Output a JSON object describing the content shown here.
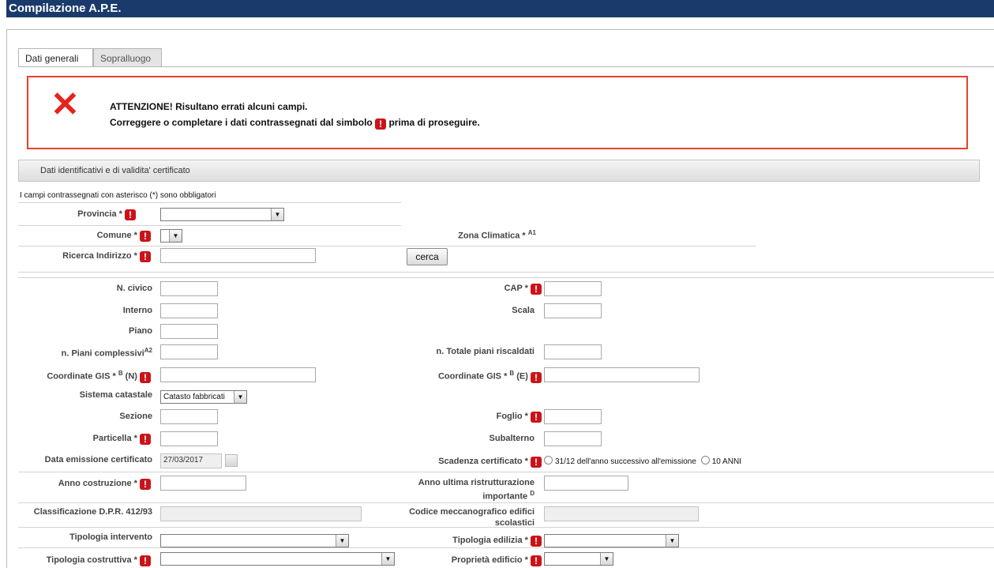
{
  "window_title": "Compilazione A.P.E.",
  "tabs": [
    {
      "label": "Dati generali"
    },
    {
      "label": "Sopralluogo"
    }
  ],
  "alert": {
    "line1": "ATTENZIONE! Risultano errati alcuni campi.",
    "line2_pre": "Correggere o completare i dati contrassegnati dal simbolo",
    "line2_post": "prima di proseguire.",
    "error_icon": "close-icon",
    "error_color": "#e8231b"
  },
  "error_marker": "!",
  "section_title": "Dati identificativi e di validita' certificato",
  "required_note": "I campi contrassegnati con asterisco (*) sono obbligatori",
  "location": {
    "provincia_label": "Provincia *",
    "comune_label": "Comune *",
    "zona_label": "Zona Climatica *",
    "zona_sup": "A1",
    "ricerca_label": "Ricerca Indirizzo *",
    "cerca_button": "cerca"
  },
  "fields": {
    "n_civico": "N. civico",
    "cap": "CAP *",
    "interno": "Interno",
    "scala": "Scala",
    "piano": "Piano",
    "n_piani": "n. Piani complessivi",
    "n_piani_sup": "A2",
    "n_totale": "n. Totale piani riscaldati",
    "gis_n_pre": "Coordinate GIS *",
    "gis_sup": "B",
    "gis_n_post": "(N)",
    "gis_e_pre": "Coordinate GIS *",
    "gis_e_post": "(E)",
    "sistema_catastale": "Sistema catastale",
    "sistema_catastale_value": "Catasto fabbricati",
    "sezione": "Sezione",
    "foglio": "Foglio *",
    "particella": "Particella *",
    "subalterno": "Subalterno",
    "data_emissione": "Data emissione certificato",
    "data_emissione_value": "27/03/2017",
    "scadenza": "Scadenza certificato *",
    "scadenza_opt1": "31/12 dell'anno successivo all'emissione",
    "scadenza_opt2": "10 ANNI",
    "anno_costruzione": "Anno costruzione *",
    "anno_ristr_l1": "Anno ultima ristrutturazione",
    "anno_ristr_l2": "importante",
    "anno_ristr_sup": "D",
    "classificazione": "Classificazione D.P.R. 412/93",
    "codice_l1": "Codice meccanografico edifici",
    "codice_l2": "scolastici",
    "tipologia_intervento": "Tipologia intervento",
    "tipologia_edilizia": "Tipologia edilizia *",
    "tipologia_costruttiva": "Tipologia costruttiva *",
    "proprieta_edificio": "Proprietà edificio *"
  }
}
